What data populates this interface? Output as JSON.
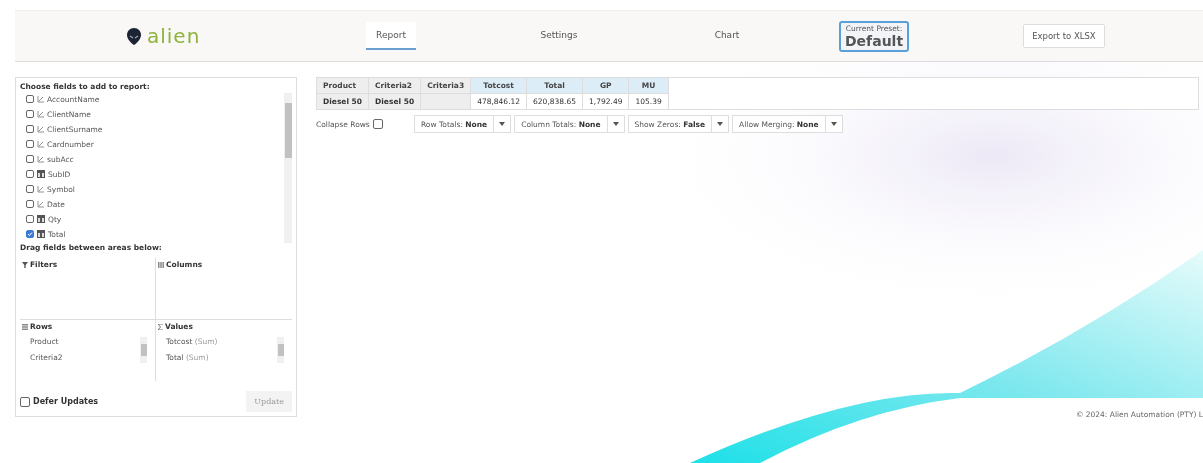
{
  "header": {
    "logo": "alien",
    "tabs": [
      {
        "label": "Report",
        "selected": true
      },
      {
        "label": "Settings",
        "selected": false
      },
      {
        "label": "Chart",
        "selected": false
      }
    ],
    "preset": {
      "label": "Current Preset:",
      "value": "Default"
    },
    "export_button": "Export to XLSX"
  },
  "field_list": {
    "title": "Choose fields to add to report:",
    "fields": [
      {
        "name": "AccountName",
        "kind": "text",
        "checked": false
      },
      {
        "name": "ClientName",
        "kind": "text",
        "checked": false
      },
      {
        "name": "ClientSurname",
        "kind": "text",
        "checked": false
      },
      {
        "name": "Cardnumber",
        "kind": "text",
        "checked": false
      },
      {
        "name": "subAcc",
        "kind": "text",
        "checked": false
      },
      {
        "name": "SubID",
        "kind": "number",
        "checked": false
      },
      {
        "name": "Symbol",
        "kind": "text",
        "checked": false
      },
      {
        "name": "Date",
        "kind": "text",
        "checked": false
      },
      {
        "name": "Qty",
        "kind": "number",
        "checked": false
      },
      {
        "name": "Total",
        "kind": "number",
        "checked": true
      }
    ],
    "drag_title": "Drag fields between areas below:",
    "filters": {
      "title": "Filters"
    },
    "columns": {
      "title": "Columns"
    },
    "rows": {
      "title": "Rows",
      "items": [
        {
          "name": "Product"
        },
        {
          "name": "Criteria2"
        }
      ]
    },
    "values": {
      "title": "Values",
      "items": [
        {
          "name": "Totcost",
          "agg": "(Sum)"
        },
        {
          "name": "Total",
          "agg": "(Sum)"
        }
      ]
    },
    "defer_updates": {
      "label": "Defer Updates",
      "checked": false
    },
    "update_button": "Update"
  },
  "table": {
    "columns": [
      {
        "label": "Product",
        "kind": "row"
      },
      {
        "label": "Criteria2",
        "kind": "row"
      },
      {
        "label": "Criteria3",
        "kind": "row"
      },
      {
        "label": "Totcost",
        "kind": "value"
      },
      {
        "label": "Total",
        "kind": "value"
      },
      {
        "label": "GP",
        "kind": "value"
      },
      {
        "label": "MU",
        "kind": "value"
      }
    ],
    "rows": [
      [
        "Diesel 50",
        "Diesel 50",
        "",
        "478,846.12",
        "620,838.65",
        "1,792.49",
        "105.39"
      ]
    ]
  },
  "options": {
    "collapse_rows": {
      "label": "Collapse Rows",
      "checked": false
    },
    "dropdowns": [
      {
        "label": "Row Totals:",
        "value": "None"
      },
      {
        "label": "Column Totals:",
        "value": "None"
      },
      {
        "label": "Show Zeros:",
        "value": "False"
      },
      {
        "label": "Allow Merging:",
        "value": "None"
      }
    ]
  },
  "footer": "© 2024: Alien Automation (PTY) L"
}
